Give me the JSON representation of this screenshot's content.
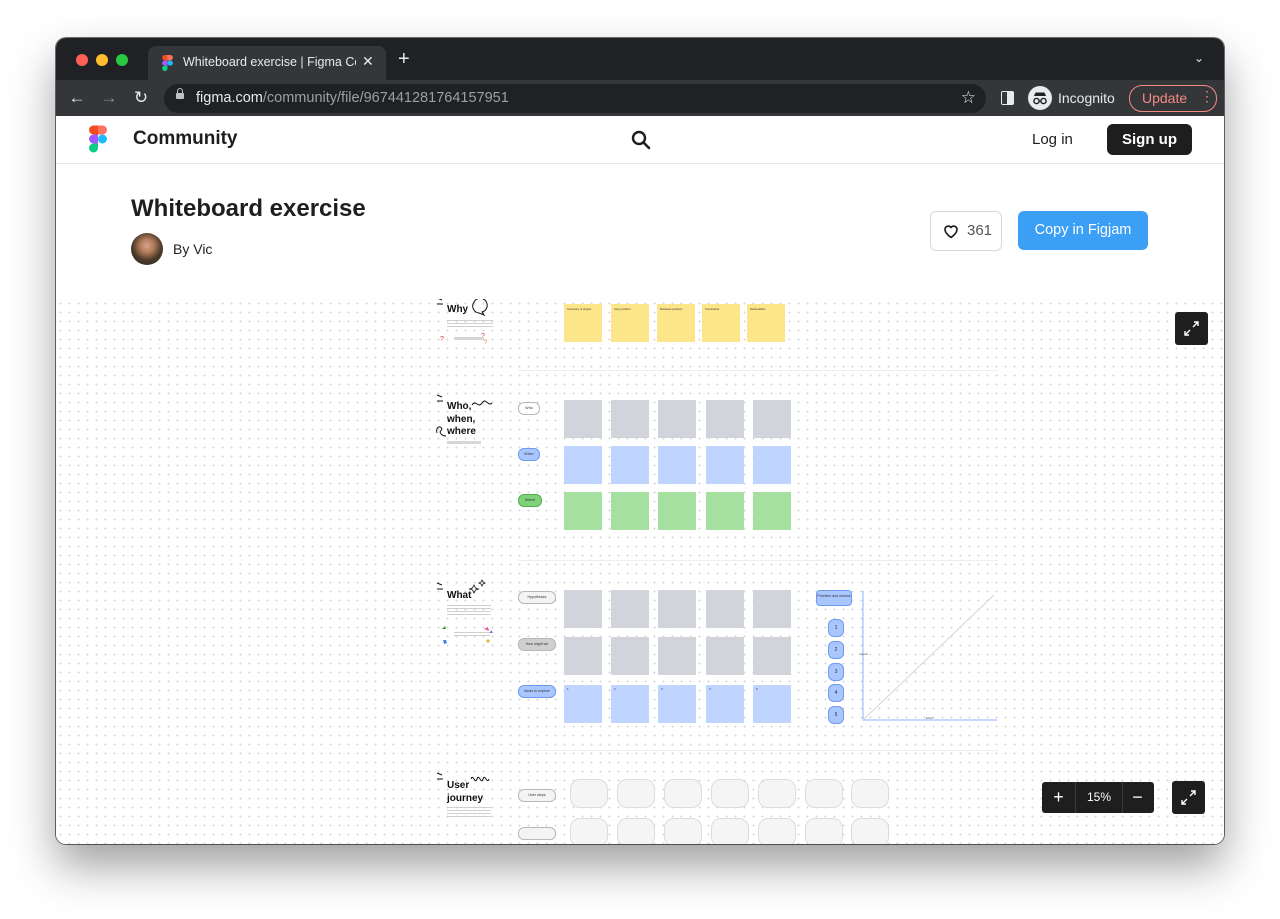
{
  "browser": {
    "tab_title": "Whiteboard exercise | Figma Community",
    "url_host": "figma.com",
    "url_path": "/community/file/967441281764157951",
    "incognito_label": "Incognito",
    "update_label": "Update"
  },
  "header": {
    "brand": "Community",
    "login": "Log in",
    "signup": "Sign up"
  },
  "file": {
    "title": "Whiteboard exercise",
    "author": "By Vic",
    "likes": "361",
    "copy_button": "Copy in Figjam"
  },
  "canvas": {
    "zoom": "15%",
    "sections": {
      "why": {
        "title": "Why",
        "sticky_labels": [
          "Summary of project",
          "User problem",
          "Business problem",
          "Constraints",
          "Deliverables"
        ],
        "sticky_color": "#fde68a"
      },
      "who": {
        "title": "Who, when, where",
        "rows": [
          "Who",
          "When",
          "Where"
        ],
        "row_colors": [
          "#d1d5db",
          "#bfd4ff",
          "#a6e0a0"
        ]
      },
      "what": {
        "title": "What",
        "rows": [
          "Hypotheses",
          "How might we",
          "Ideas to explore"
        ],
        "prioritize": "Prioritize and choose",
        "priorities": [
          "1",
          "2",
          "3",
          "4",
          "5"
        ],
        "ideas": [
          "1",
          "2",
          "3",
          "4",
          "5"
        ],
        "y_axis": "Impact",
        "x_axis": "Effort"
      },
      "journey": {
        "title": "User journey",
        "row": "User steps"
      }
    }
  }
}
